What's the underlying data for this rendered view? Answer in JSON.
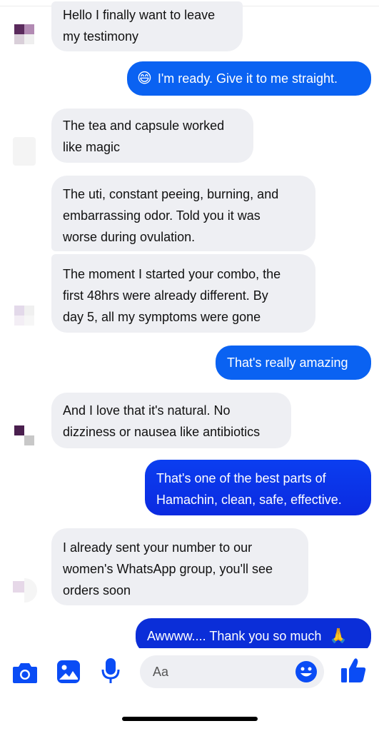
{
  "colors": {
    "accent": "#0a4cf5",
    "incoming_bubble": "#eeeff3",
    "outgoing_gradient_top": "#0b5cf0",
    "outgoing_gradient_bottom": "#0b26d8"
  },
  "messages": [
    {
      "sender": "contact",
      "lines": [
        "Hello I finally want to leave",
        "my testimony"
      ]
    },
    {
      "sender": "me",
      "emoji": "😄",
      "lines": [
        "I'm ready. Give it to me straight."
      ]
    },
    {
      "sender": "contact",
      "lines": [
        "The tea and capsule worked",
        "like magic"
      ]
    },
    {
      "sender": "contact",
      "lines": [
        "The uti, constant peeing, burning, and",
        "embarrassing odor. Told you it was",
        "worse during ovulation."
      ]
    },
    {
      "sender": "contact",
      "lines": [
        "The moment I started your combo, the",
        "first 48hrs were already different. By",
        "day 5, all my symptoms were gone"
      ]
    },
    {
      "sender": "me",
      "lines": [
        "That's really amazing"
      ]
    },
    {
      "sender": "contact",
      "lines": [
        "And I love that it's natural. No",
        "dizziness or nausea like antibiotics"
      ]
    },
    {
      "sender": "me",
      "lines": [
        "That's one of the best parts of",
        "Hamachin, clean, safe, effective."
      ]
    },
    {
      "sender": "contact",
      "lines": [
        "I already sent your number to our",
        "women's WhatsApp group, you'll see",
        "orders soon"
      ]
    },
    {
      "sender": "me",
      "emoji_after": "🙏",
      "lines": [
        "Awwww.... Thank you so much"
      ]
    }
  ],
  "composer": {
    "placeholder": "Aa",
    "icons": [
      "camera-icon",
      "photo-icon",
      "microphone-icon",
      "emoji-icon",
      "thumbs-up-icon"
    ]
  }
}
